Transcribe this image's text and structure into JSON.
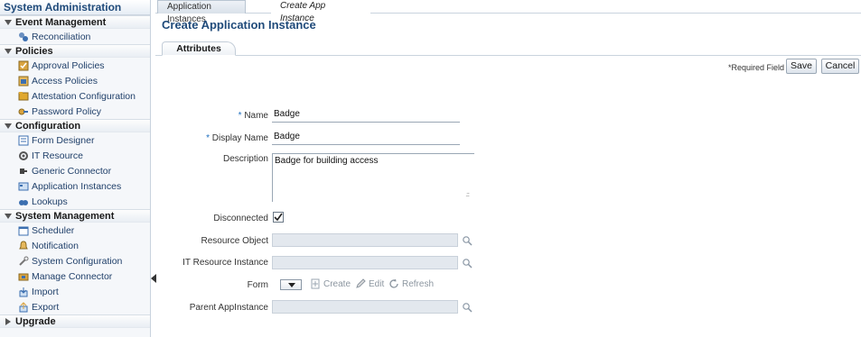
{
  "sidebar": {
    "title": "System Administration",
    "sections": [
      {
        "label": "Event Management",
        "items": [
          {
            "label": "Reconciliation",
            "icon": "reconciliation-icon"
          }
        ]
      },
      {
        "label": "Policies",
        "items": [
          {
            "label": "Approval Policies",
            "icon": "approval-policy-icon"
          },
          {
            "label": "Access Policies",
            "icon": "access-policy-icon"
          },
          {
            "label": "Attestation Configuration",
            "icon": "attestation-icon"
          },
          {
            "label": "Password Policy",
            "icon": "password-policy-icon"
          }
        ]
      },
      {
        "label": "Configuration",
        "items": [
          {
            "label": "Form Designer",
            "icon": "form-designer-icon"
          },
          {
            "label": "IT Resource",
            "icon": "it-resource-icon"
          },
          {
            "label": "Generic Connector",
            "icon": "generic-connector-icon"
          },
          {
            "label": "Application Instances",
            "icon": "application-instances-icon"
          },
          {
            "label": "Lookups",
            "icon": "lookups-icon"
          }
        ]
      },
      {
        "label": "System Management",
        "items": [
          {
            "label": "Scheduler",
            "icon": "scheduler-icon"
          },
          {
            "label": "Notification",
            "icon": "notification-bell-icon"
          },
          {
            "label": "System Configuration",
            "icon": "system-configuration-icon"
          },
          {
            "label": "Manage Connector",
            "icon": "manage-connector-icon"
          },
          {
            "label": "Import",
            "icon": "import-icon"
          },
          {
            "label": "Export",
            "icon": "export-icon"
          }
        ]
      },
      {
        "label": "Upgrade",
        "items": []
      }
    ]
  },
  "tabs": [
    {
      "label": "Application Instances"
    },
    {
      "label": "Create App Instance"
    }
  ],
  "page": {
    "title": "Create Application Instance",
    "subtab": "Attributes",
    "required_note": "*Required Field",
    "save_label": "Save",
    "cancel_label": "Cancel"
  },
  "form": {
    "name_label": "Name",
    "name_value": "Badge",
    "display_name_label": "Display Name",
    "display_name_value": "Badge",
    "description_label": "Description",
    "description_value": "Badge for building access",
    "disconnected_label": "Disconnected",
    "disconnected_checked": true,
    "resource_object_label": "Resource Object",
    "it_resource_instance_label": "IT Resource Instance",
    "form_label": "Form",
    "form_create": "Create",
    "form_edit": "Edit",
    "form_refresh": "Refresh",
    "parent_appinstance_label": "Parent AppInstance"
  },
  "colors": {
    "accent": "#1f4a7a",
    "required_star": "#1f6fbf",
    "sidebar_bg": "#f5f7fa"
  }
}
